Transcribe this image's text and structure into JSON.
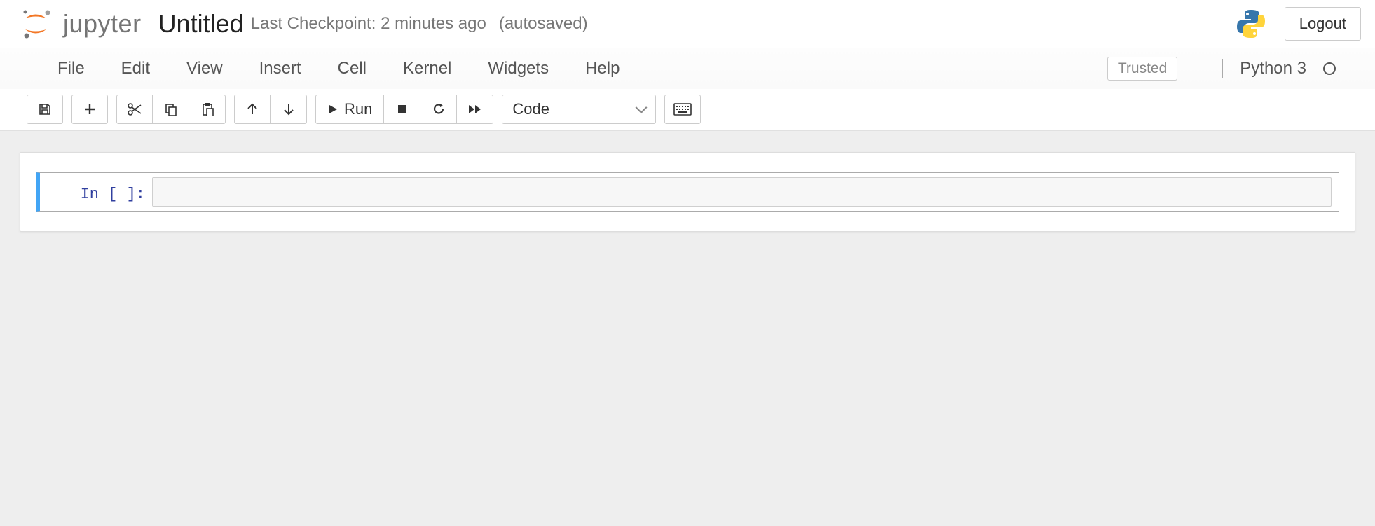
{
  "header": {
    "brand": "jupyter",
    "notebook_name": "Untitled",
    "checkpoint": "Last Checkpoint: 2 minutes ago",
    "autosaved": "(autosaved)",
    "logout_label": "Logout"
  },
  "menubar": {
    "items": [
      "File",
      "Edit",
      "View",
      "Insert",
      "Cell",
      "Kernel",
      "Widgets",
      "Help"
    ],
    "trusted_label": "Trusted",
    "kernel_name": "Python 3"
  },
  "toolbar": {
    "run_label": "Run",
    "cell_type_value": "Code"
  },
  "cells": [
    {
      "prompt": "In [ ]:",
      "source": ""
    }
  ]
}
